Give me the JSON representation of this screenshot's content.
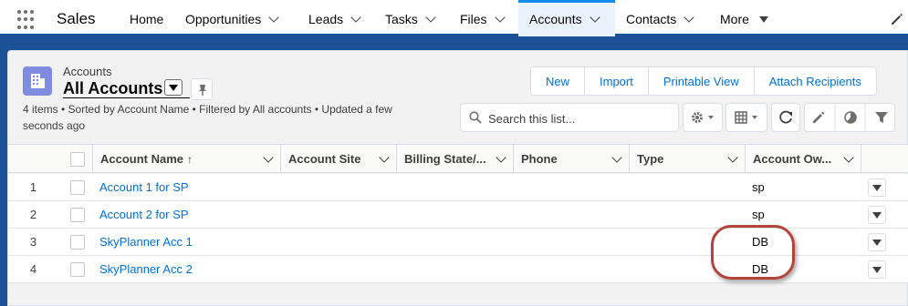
{
  "nav": {
    "app_name": "Sales",
    "items": [
      {
        "label": "Home",
        "chevron": false
      },
      {
        "label": "Opportunities",
        "chevron": true
      },
      {
        "label": "Leads",
        "chevron": true
      },
      {
        "label": "Tasks",
        "chevron": true
      },
      {
        "label": "Files",
        "chevron": true
      },
      {
        "label": "Accounts",
        "chevron": true,
        "active": true
      },
      {
        "label": "Contacts",
        "chevron": true
      },
      {
        "label": "More",
        "chevron": false
      }
    ]
  },
  "header": {
    "breadcrumb": "Accounts",
    "list_view_name": "All Accounts",
    "meta": "4 items • Sorted by Account Name • Filtered by All accounts • Updated a few seconds ago",
    "icon": "accounts-icon",
    "buttons": [
      "New",
      "Import",
      "Printable View",
      "Attach Recipients"
    ]
  },
  "search": {
    "placeholder": "Search this list..."
  },
  "table": {
    "columns": [
      "Account Name",
      "Account Site",
      "Billing State/...",
      "Phone",
      "Type",
      "Account Ow..."
    ],
    "sort_indicator": "↑",
    "rows": [
      {
        "num": "1",
        "name": "Account 1 for SP",
        "owner": "sp"
      },
      {
        "num": "2",
        "name": "Account 2 for SP",
        "owner": "sp"
      },
      {
        "num": "3",
        "name": "SkyPlanner Acc 1",
        "owner": "DB"
      },
      {
        "num": "4",
        "name": "SkyPlanner Acc 2",
        "owner": "DB"
      }
    ]
  },
  "colors": {
    "brand": "#1b5297",
    "link": "#0070d2",
    "accounts_icon": "#7f8de1",
    "annotation": "#b3443a"
  }
}
